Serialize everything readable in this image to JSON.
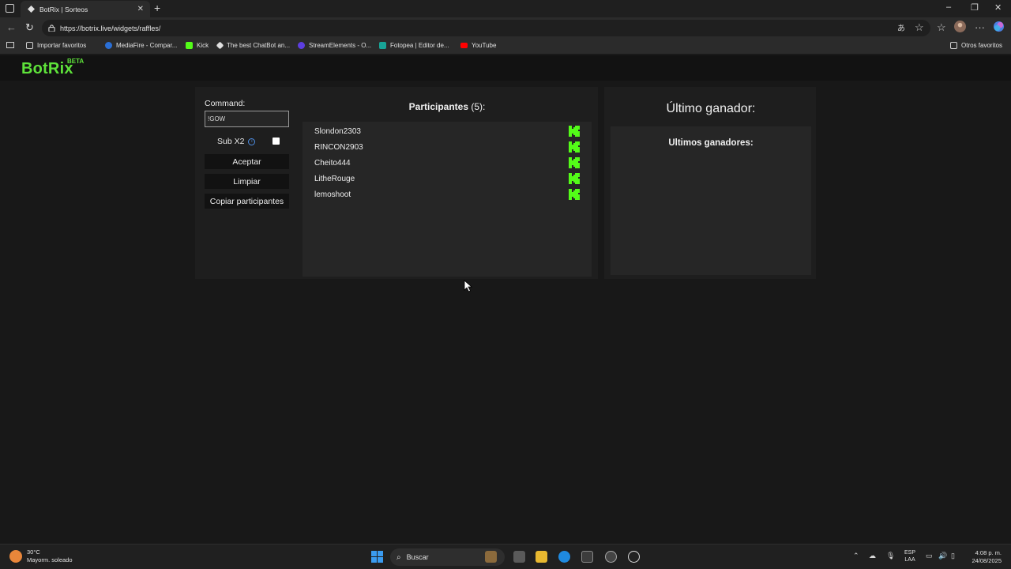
{
  "browser": {
    "tab_title": "BotRix | Sorteos",
    "new_tab": "+",
    "url": "https://botrix.live/widgets/raffles/",
    "bookmarks": [
      {
        "label": "Importar favoritos"
      },
      {
        "label": "MediaFire - Compar..."
      },
      {
        "label": "Kick"
      },
      {
        "label": "The best ChatBot an..."
      },
      {
        "label": "StreamElements - O..."
      },
      {
        "label": "Fotopea | Editor de..."
      },
      {
        "label": "YouTube"
      }
    ],
    "other_favorites": "Otros favoritos",
    "minimize": "–",
    "restore": "❐",
    "close": "✕",
    "tab_close": "✕"
  },
  "site": {
    "logo": "BotRix",
    "beta": "BETA",
    "accent": "#5ee23a"
  },
  "raffle": {
    "command_label": "Command:",
    "command_value": "!GOW",
    "sub_label": "Sub X2",
    "sub_checked": false,
    "accept_button": "Aceptar",
    "clear_button": "Limpiar",
    "copy_button": "Copiar participantes",
    "participants_label": "Participantes",
    "participants_count": "(5):",
    "participants": [
      {
        "name": "Slondon2303",
        "platform": "kick-icon"
      },
      {
        "name": "RINCON2903",
        "platform": "kick-icon"
      },
      {
        "name": "Cheito444",
        "platform": "kick-icon"
      },
      {
        "name": "LitheRouge",
        "platform": "kick-icon"
      },
      {
        "name": "lemoshoot",
        "platform": "kick-icon"
      }
    ],
    "last_winner_label": "Último ganador:",
    "last_winners_label": "Ultimos ganadores:"
  },
  "taskbar": {
    "temperature": "30°C",
    "weather": "Mayorm. soleado",
    "search": "Buscar",
    "lang_top": "ESP",
    "lang_bottom": "LAA",
    "time": "4:08 p. m.",
    "date": "24/08/2025"
  }
}
